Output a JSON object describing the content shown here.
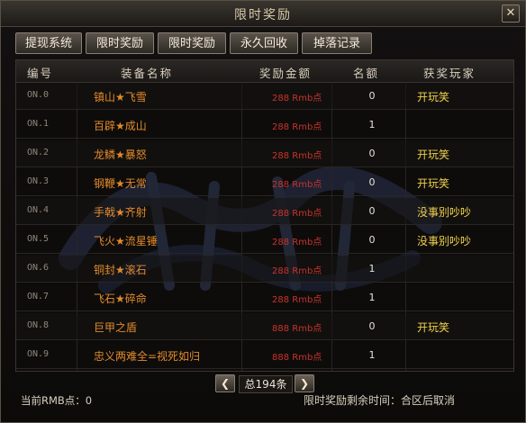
{
  "window": {
    "title": "限时奖励",
    "close_glyph": "✕"
  },
  "tabs": [
    {
      "label": "提现系统"
    },
    {
      "label": "限时奖励"
    },
    {
      "label": "限时奖励"
    },
    {
      "label": "永久回收"
    },
    {
      "label": "掉落记录"
    }
  ],
  "table": {
    "headers": {
      "index": "编号",
      "item": "装备名称",
      "amount": "奖励金额",
      "quota": "名额",
      "winner": "获奖玩家"
    },
    "rows": [
      {
        "index": "ON.0",
        "item": "镇山★飞雪",
        "amount": "288 Rmb点",
        "quota": "0",
        "winner": "开玩笑"
      },
      {
        "index": "ON.1",
        "item": "百辟★成山",
        "amount": "288 Rmb点",
        "quota": "1",
        "winner": ""
      },
      {
        "index": "ON.2",
        "item": "龙鳞★暴怒",
        "amount": "288 Rmb点",
        "quota": "0",
        "winner": "开玩笑"
      },
      {
        "index": "ON.3",
        "item": "钢鞭★无常",
        "amount": "288 Rmb点",
        "quota": "0",
        "winner": "开玩笑"
      },
      {
        "index": "ON.4",
        "item": "手戟★齐射",
        "amount": "288 Rmb点",
        "quota": "0",
        "winner": "没事别吵吵"
      },
      {
        "index": "ON.5",
        "item": "飞火★流星锤",
        "amount": "288 Rmb点",
        "quota": "0",
        "winner": "没事别吵吵"
      },
      {
        "index": "ON.6",
        "item": "铜封★滚石",
        "amount": "288 Rmb点",
        "quota": "1",
        "winner": ""
      },
      {
        "index": "ON.7",
        "item": "飞石★碎命",
        "amount": "288 Rmb点",
        "quota": "1",
        "winner": ""
      },
      {
        "index": "ON.8",
        "item": "巨甲之盾",
        "amount": "888 Rmb点",
        "quota": "0",
        "winner": "开玩笑"
      },
      {
        "index": "ON.9",
        "item": "忠义两难全=视死如归",
        "amount": "888 Rmb点",
        "quota": "1",
        "winner": ""
      }
    ]
  },
  "pager": {
    "prev_glyph": "❮",
    "next_glyph": "❯",
    "total": "总194条"
  },
  "footer": {
    "rmb_points": "当前RMB点：0",
    "remaining_time": "限时奖励剩余时间：合区后取消"
  },
  "colors": {
    "item": "#e38a2a",
    "amount": "#c8332b",
    "winner": "#f0d04a"
  }
}
